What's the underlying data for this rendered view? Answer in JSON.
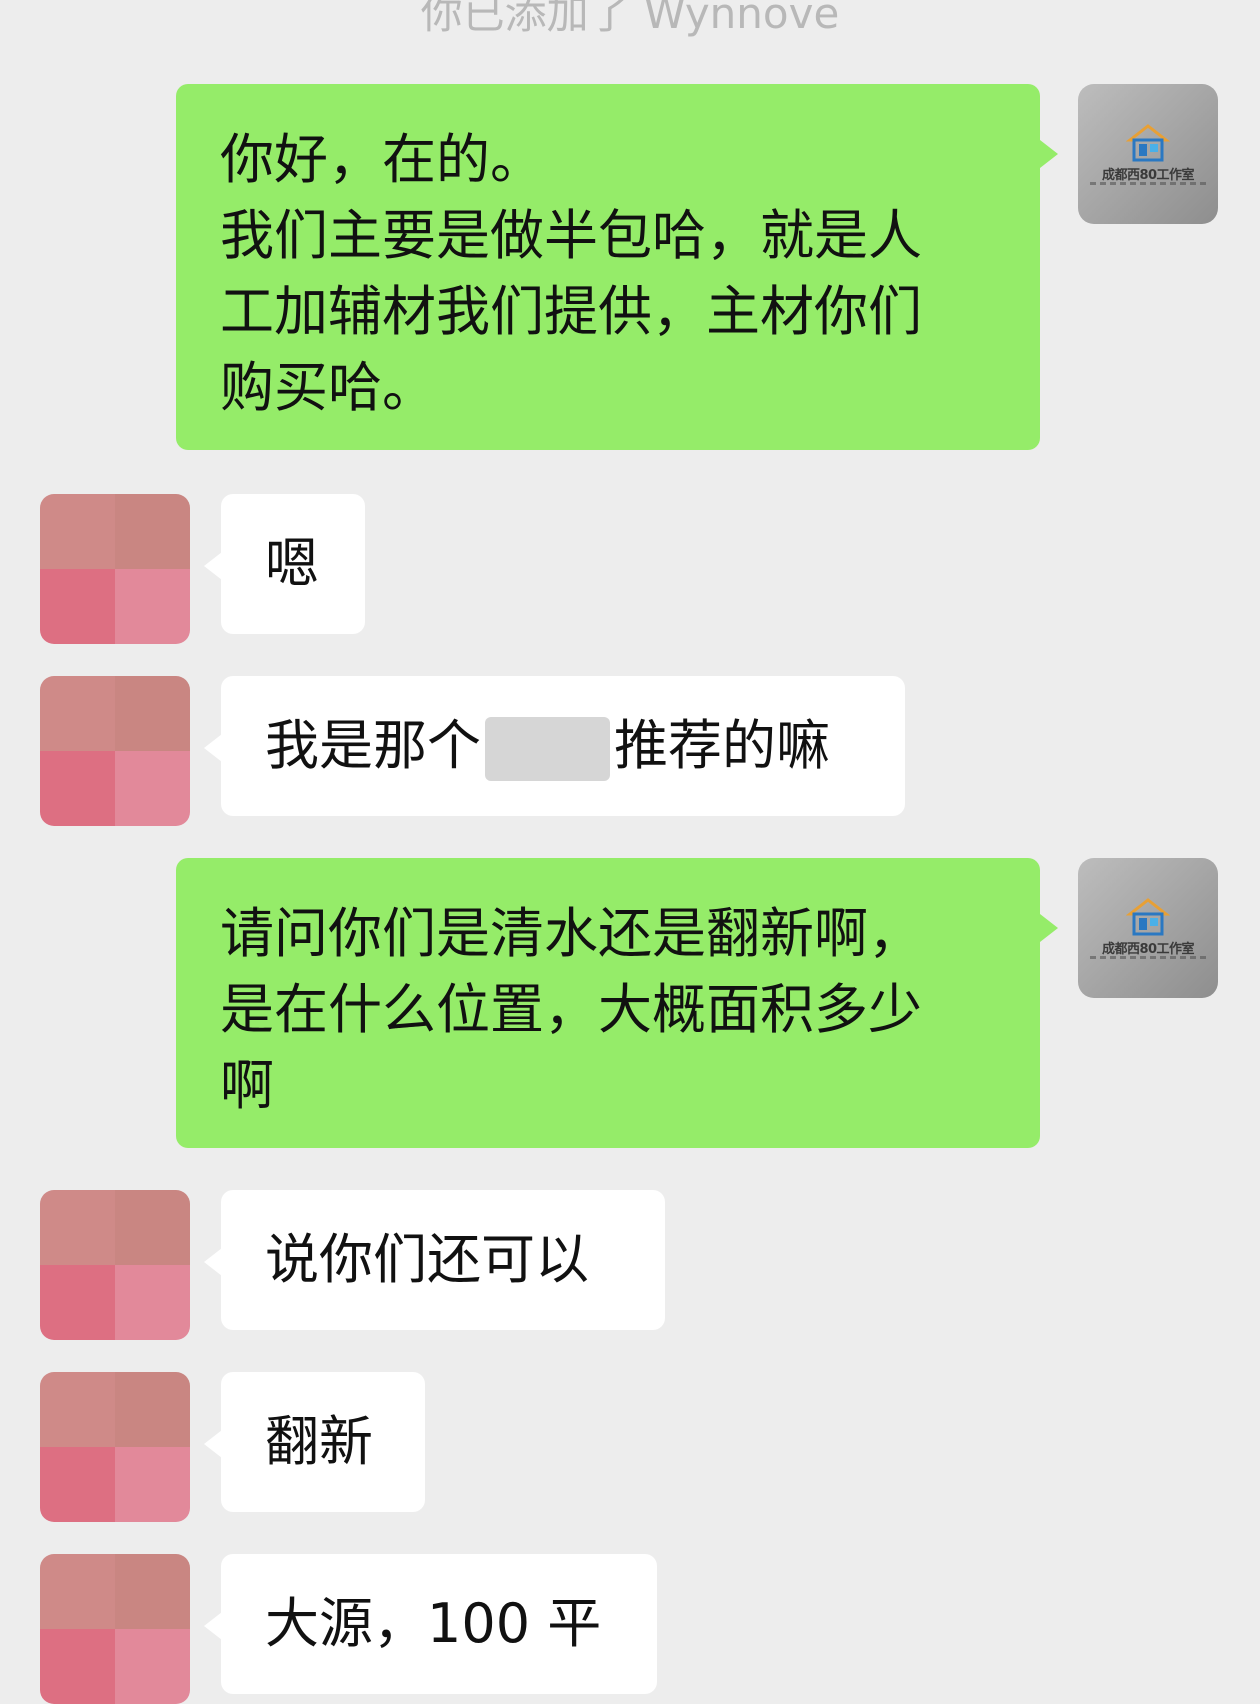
{
  "system_note": "你已添加了 Wynnove",
  "messages": [
    {
      "from": "me",
      "lines": [
        "你好，在的。",
        "我们主要是做半包哈，就是人",
        "工加辅材我们提供，主材你们",
        "购买哈。"
      ]
    },
    {
      "from": "them",
      "text": "嗯"
    },
    {
      "from": "them",
      "text_before": "我是那个",
      "text_after": "推荐的嘛"
    },
    {
      "from": "me",
      "lines": [
        "请问你们是清水还是翻新啊，",
        "是在什么位置，大概面积多少",
        "啊"
      ]
    },
    {
      "from": "them",
      "text": "说你们还可以"
    },
    {
      "from": "them",
      "text": "翻新"
    },
    {
      "from": "them",
      "text": "大源，100 平"
    }
  ],
  "my_avatar": {
    "brand_text": "成都西80工作室",
    "icon": "house-logo-icon"
  },
  "colors": {
    "my_bubble": "#95ec69",
    "their_bubble": "#ffffff",
    "background": "#ededed"
  }
}
